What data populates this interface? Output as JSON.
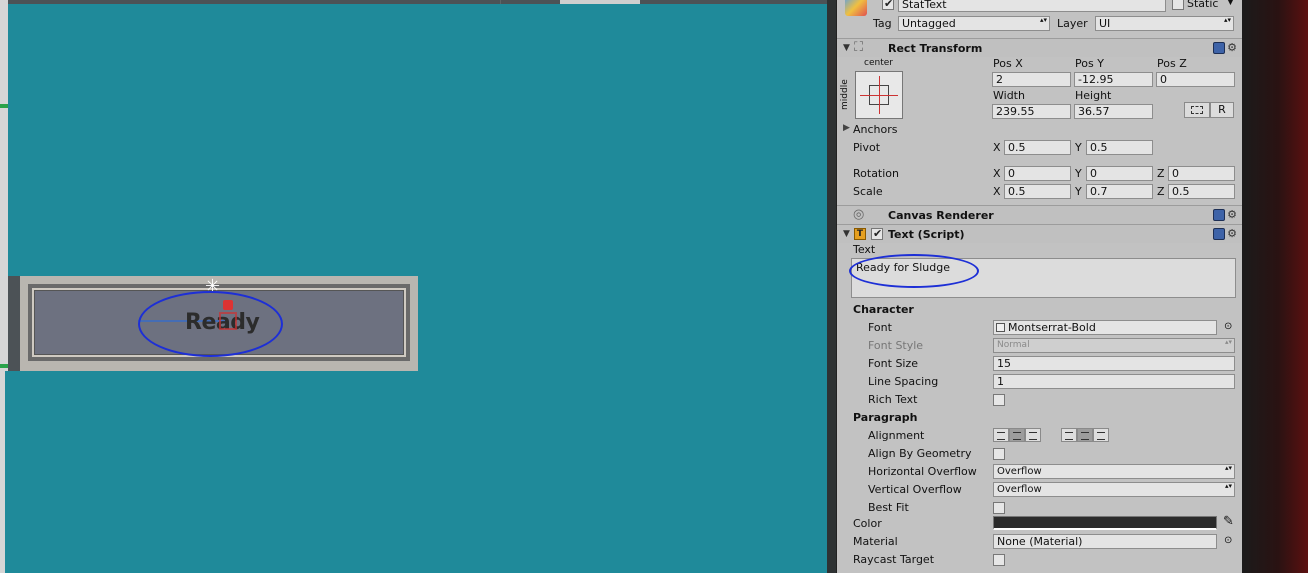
{
  "scene": {
    "canvas_text": "Ready"
  },
  "inspector": {
    "object_name": "StatText",
    "static_label": "Static",
    "tag_label": "Tag",
    "tag_value": "Untagged",
    "layer_label": "Layer",
    "layer_value": "UI",
    "rect_transform": {
      "title": "Rect Transform",
      "anchor_h": "center",
      "anchor_v": "middle",
      "pos_x_label": "Pos X",
      "pos_y_label": "Pos Y",
      "pos_z_label": "Pos Z",
      "pos_x": "2",
      "pos_y": "-12.95",
      "pos_z": "0",
      "width_label": "Width",
      "height_label": "Height",
      "width": "239.55",
      "height": "36.57",
      "r_button": "R",
      "anchors_label": "Anchors",
      "pivot_label": "Pivot",
      "pivot_x": "0.5",
      "pivot_y": "0.5",
      "rotation_label": "Rotation",
      "rot_x": "0",
      "rot_y": "0",
      "rot_z": "0",
      "scale_label": "Scale",
      "scale_x": "0.5",
      "scale_y": "0.7",
      "scale_z": "0.5",
      "x": "X",
      "y": "Y",
      "z": "Z"
    },
    "canvas_renderer": {
      "title": "Canvas Renderer"
    },
    "text_script": {
      "title": "Text (Script)",
      "text_label": "Text",
      "text_value": "Ready for Sludge",
      "character_label": "Character",
      "font_label": "Font",
      "font_value": "Montserrat-Bold",
      "font_style_label": "Font Style",
      "font_style_value": "Normal",
      "font_size_label": "Font Size",
      "font_size_value": "15",
      "line_spacing_label": "Line Spacing",
      "line_spacing_value": "1",
      "rich_text_label": "Rich Text",
      "paragraph_label": "Paragraph",
      "alignment_label": "Alignment",
      "align_geometry_label": "Align By Geometry",
      "h_overflow_label": "Horizontal Overflow",
      "h_overflow_value": "Overflow",
      "v_overflow_label": "Vertical Overflow",
      "v_overflow_value": "Overflow",
      "best_fit_label": "Best Fit",
      "color_label": "Color",
      "color_value": "#2b2b2b",
      "material_label": "Material",
      "material_value": "None (Material)",
      "raycast_label": "Raycast Target"
    }
  },
  "icons": [
    "gameobject-cube-icon",
    "rect-transform-icon",
    "canvas-renderer-icon",
    "text-script-icon",
    "help-book-icon",
    "gear-icon",
    "eyedropper-icon",
    "object-picker-icon"
  ]
}
